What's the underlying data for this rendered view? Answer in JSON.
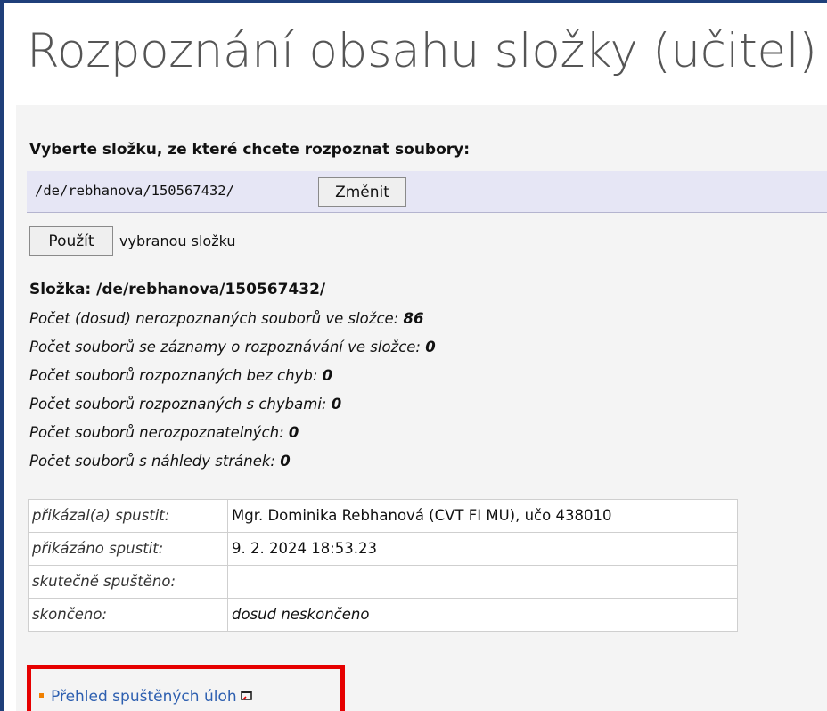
{
  "page": {
    "title": "Rozpoznání obsahu složky (učitel)"
  },
  "folder_select": {
    "prompt": "Vyberte složku, ze které chcete rozpoznat soubory:",
    "path": "/de/rebhanova/150567432/",
    "change_label": "Změnit",
    "use_label": "Použít",
    "use_suffix": "vybranou složku"
  },
  "folder_info": {
    "heading": "Složka: /de/rebhanova/150567432/",
    "stats": [
      {
        "label": "Počet (dosud) nerozpoznaných souborů ve složce:",
        "value": "86"
      },
      {
        "label": "Počet souborů se záznamy o rozpoznávání ve složce:",
        "value": "0"
      },
      {
        "label": "Počet souborů rozpoznaných bez chyb:",
        "value": "0"
      },
      {
        "label": "Počet souborů rozpoznaných s chybami:",
        "value": "0"
      },
      {
        "label": "Počet souborů nerozpoznatelných:",
        "value": "0"
      },
      {
        "label": "Počet souborů s náhledy stránek:",
        "value": "0"
      }
    ]
  },
  "job_table": {
    "rows": [
      {
        "label": "přikázal(a) spustit:",
        "value": "Mgr. Dominika Rebhanová (CVT FI MU), učo 438010"
      },
      {
        "label": "přikázáno spustit:",
        "value": "9. 2. 2024 18:53.23"
      },
      {
        "label": "skutečně spuštěno:",
        "value": ""
      },
      {
        "label": "skončeno:",
        "value": "dosud neskončeno"
      }
    ]
  },
  "links": {
    "overview_label": "Přehled spuštěných úloh"
  },
  "colors": {
    "frame": "#1f3f7a",
    "panel_bg": "#f4f4f4",
    "folder_row_bg": "#e6e6f5",
    "link": "#2d5fb0",
    "bullet": "#f08000",
    "highlight": "#e60000"
  },
  "icons": {
    "external_link": "external-link-icon",
    "bullet": "bullet-icon"
  }
}
